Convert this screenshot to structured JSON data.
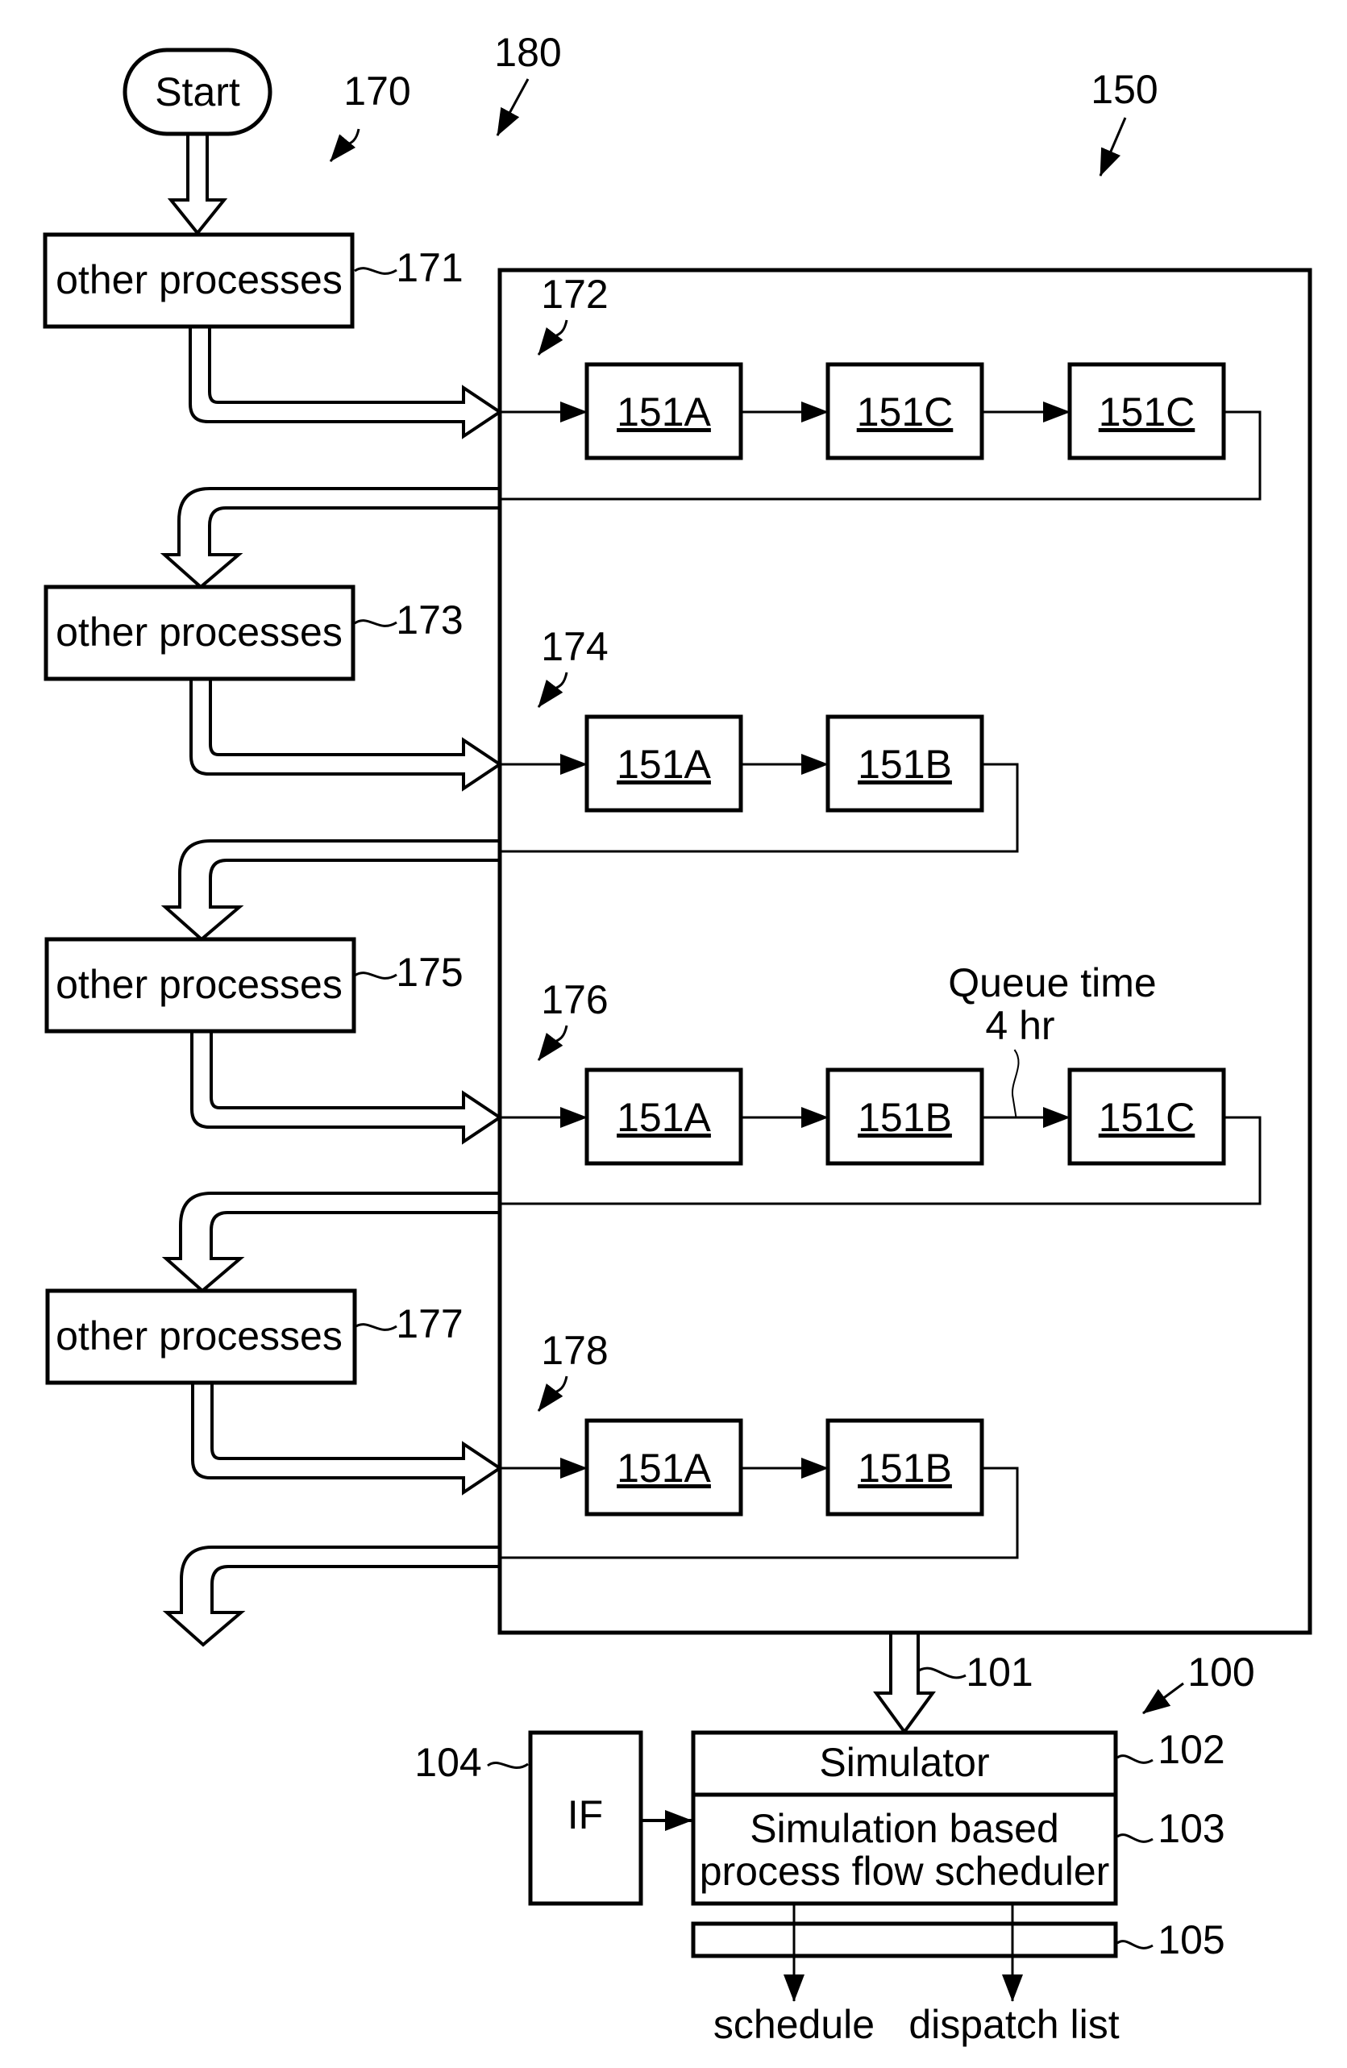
{
  "figure": {
    "start_label": "Start",
    "labels": {
      "system": "150",
      "flow": "170",
      "flow_group": "180",
      "simulator_system": "100",
      "data_arrow": "101",
      "simulator_ref": "102",
      "scheduler_ref": "103",
      "interface_ref": "104",
      "output_ref": "105"
    },
    "other_process_steps": [
      {
        "ref": "171",
        "text": "other processes"
      },
      {
        "ref": "173",
        "text": "other processes"
      },
      {
        "ref": "175",
        "text": "other processes"
      },
      {
        "ref": "177",
        "text": "other processes"
      }
    ],
    "process_flows": [
      {
        "ref": "172",
        "modules": [
          "151A",
          "151C",
          "151C"
        ],
        "annotation": null
      },
      {
        "ref": "174",
        "modules": [
          "151A",
          "151B"
        ],
        "annotation": null
      },
      {
        "ref": "176",
        "modules": [
          "151A",
          "151B",
          "151C"
        ],
        "annotation": {
          "line1": "Queue time",
          "line2": "4 hr",
          "between": [
            1,
            2
          ]
        }
      },
      {
        "ref": "178",
        "modules": [
          "151A",
          "151B"
        ],
        "annotation": null
      }
    ],
    "simulator_label": "Simulator",
    "scheduler_line1": "Simulation based",
    "scheduler_line2": "process flow scheduler",
    "interface_label": "IF",
    "outputs": [
      "schedule",
      "dispatch list"
    ]
  }
}
